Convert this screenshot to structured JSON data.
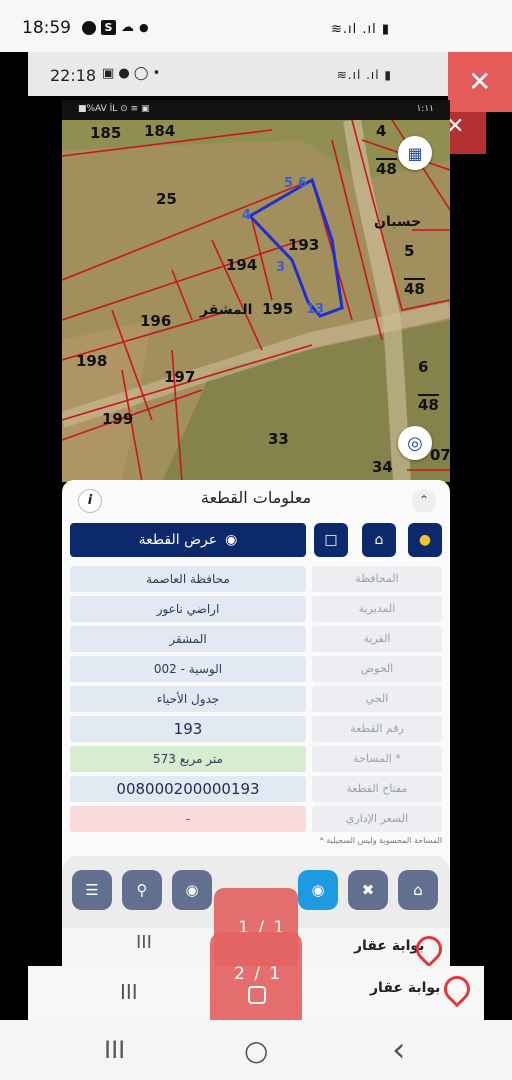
{
  "outer_status": {
    "time": "18:59",
    "signal": "≋.ıl .ıl ▮"
  },
  "inner_status": {
    "time": "22:18",
    "signal": "≋.ıl .ıl ▮"
  },
  "map_status": {
    "left": "■%AV İL ⊙ ≡ ▣",
    "right": "١:١١"
  },
  "close_symbol": "✕",
  "map": {
    "plots": [
      "185",
      "184",
      "25",
      "194",
      "193",
      "196",
      "195",
      "198",
      "197",
      "199",
      "33",
      "34",
      "4",
      "48",
      "5",
      "48",
      "6",
      "48",
      "07"
    ],
    "highlight_vertices": [
      "5",
      "6",
      "4",
      "3",
      "13"
    ],
    "area_name": "المشقر",
    "village_name": "حسبان"
  },
  "panel": {
    "title": "معلومات القطعة",
    "info_label": "i",
    "show_plot_label": "عرض القطعة",
    "rows": [
      {
        "label": "المحافظة",
        "value": "محافظة العاصمة"
      },
      {
        "label": "المديرية",
        "value": "اراضي ناعور"
      },
      {
        "label": "القرية",
        "value": "المشقر"
      },
      {
        "label": "الحوض",
        "value": "الوسية - 002"
      },
      {
        "label": "الحي",
        "value": "جدول الأحياء"
      },
      {
        "label": "رقم القطعة",
        "value": "193"
      },
      {
        "label": "المساحة *",
        "value": "573 متر مربع"
      },
      {
        "label": "مفتاح القطعة",
        "value": "008000200000193"
      },
      {
        "label": "السعر الإداري",
        "value": "-"
      }
    ],
    "footnote": "* المساحة المحسوبة وليس السجيلية"
  },
  "toolbar": {
    "icons": [
      "list-icon",
      "search-icon",
      "pin-icon",
      "location-icon",
      "tools-icon",
      "home-icon"
    ]
  },
  "brand": "بوابة عقار",
  "pages": {
    "inner": "1 / 1",
    "outer": "2 / 1"
  },
  "nav": {
    "recent": "III",
    "home": "○",
    "back": "‹"
  },
  "colors": {
    "navy": "#0c2a6b",
    "highlight_blue": "#3b5bd9",
    "overlay_red": "#e46464",
    "brand_red": "#e0383b"
  }
}
